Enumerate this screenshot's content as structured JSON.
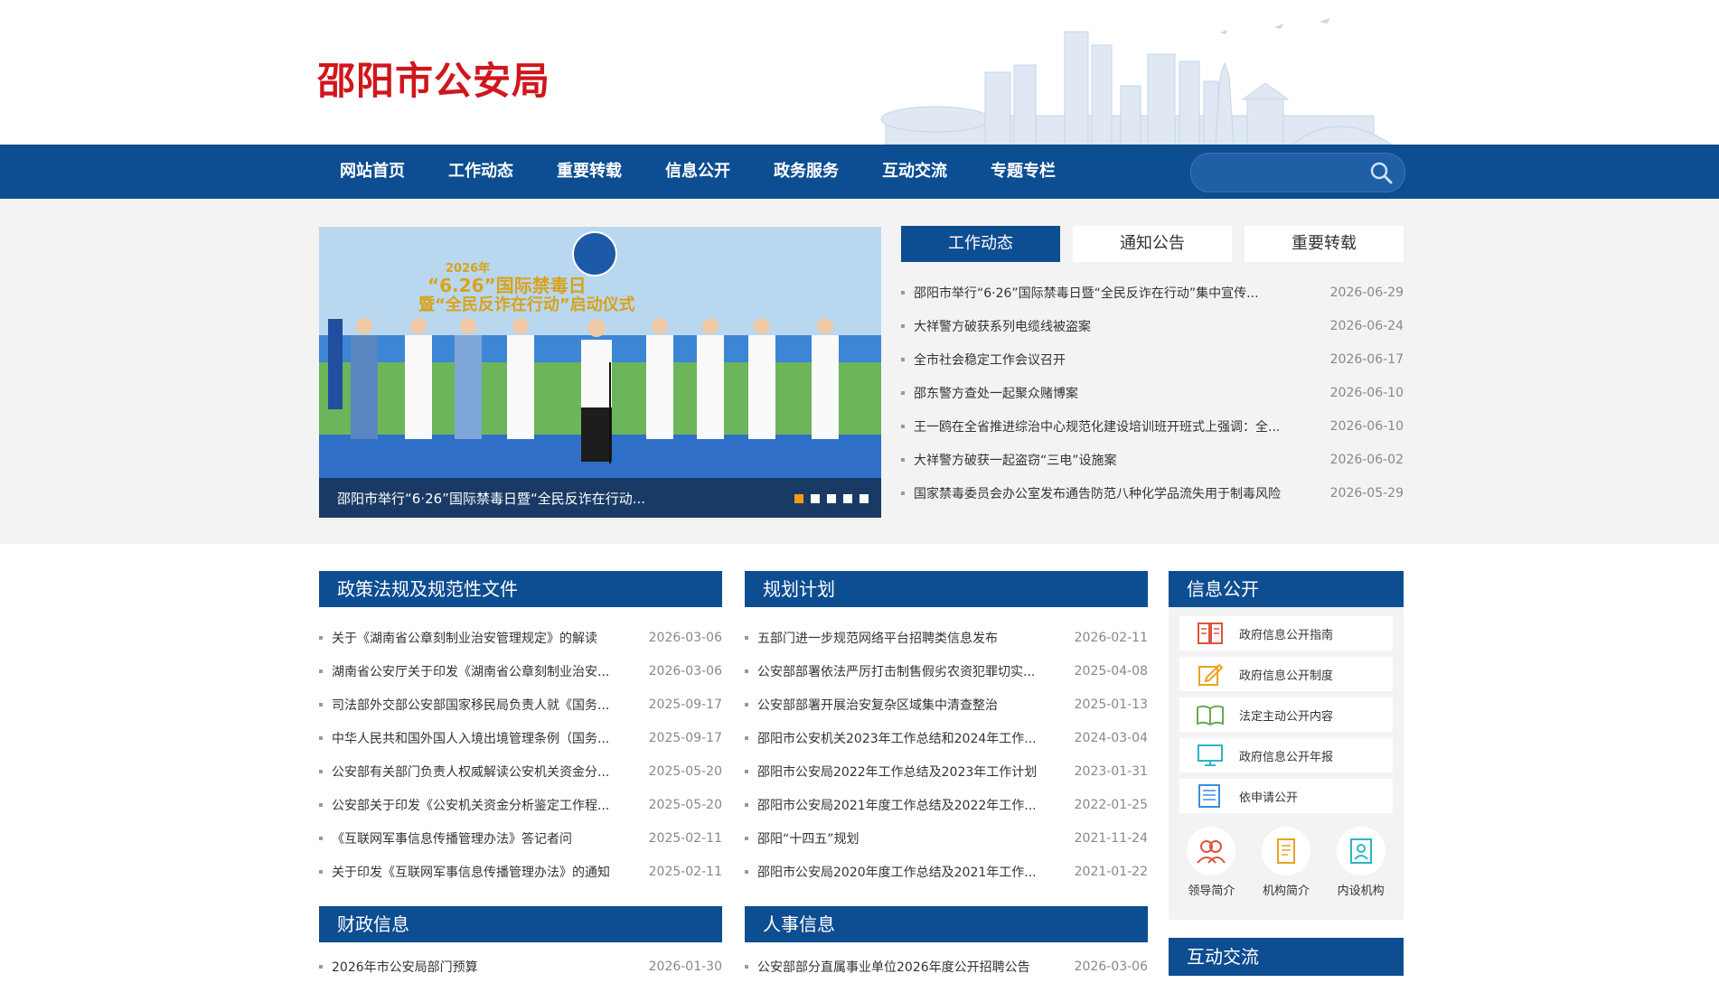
{
  "site": {
    "title": "邵阳市公安局"
  },
  "nav": {
    "items": [
      "网站首页",
      "工作动态",
      "重要转载",
      "信息公开",
      "政务服务",
      "互动交流",
      "专题专栏"
    ],
    "search_placeholder": ""
  },
  "slider": {
    "caption": "邵阳市举行“6·26”国际禁毒日暨“全民反诈在行动...",
    "banner_line1": "2026年",
    "banner_line2": "“6.26”国际禁毒日",
    "banner_line3": "暨“全民反诈在行动”启动仪式"
  },
  "tabs": [
    "工作动态",
    "通知公告",
    "重要转载"
  ],
  "top_news": [
    {
      "title": "邵阳市举行“6·26”国际禁毒日暨“全民反诈在行动”集中宣传...",
      "date": "2026-06-29"
    },
    {
      "title": "大祥警方破获系列电缆线被盗案",
      "date": "2026-06-24"
    },
    {
      "title": "全市社会稳定工作会议召开",
      "date": "2026-06-17"
    },
    {
      "title": "邵东警方查处一起聚众赌博案",
      "date": "2026-06-10"
    },
    {
      "title": "王一鸥在全省推进综治中心规范化建设培训班开班式上强调：全...",
      "date": "2026-06-10"
    },
    {
      "title": "大祥警方破获一起盗窃“三电”设施案",
      "date": "2026-06-02"
    },
    {
      "title": "国家禁毒委员会办公室发布通告防范八种化学品流失用于制毒风险",
      "date": "2026-05-29"
    }
  ],
  "policy": {
    "heading": "政策法规及规范性文件",
    "items": [
      {
        "title": "关于《湖南省公章刻制业治安管理规定》的解读",
        "date": "2026-03-06"
      },
      {
        "title": "湖南省公安厅关于印发《湖南省公章刻制业治安...",
        "date": "2026-03-06"
      },
      {
        "title": "司法部外交部公安部国家移民局负责人就《国务...",
        "date": "2025-09-17"
      },
      {
        "title": "中华人民共和国外国人入境出境管理条例（国务...",
        "date": "2025-09-17"
      },
      {
        "title": "公安部有关部门负责人权威解读公安机关资金分...",
        "date": "2025-05-20"
      },
      {
        "title": "公安部关于印发《公安机关资金分析鉴定工作程...",
        "date": "2025-05-20"
      },
      {
        "title": "《互联网军事信息传播管理办法》答记者问",
        "date": "2025-02-11"
      },
      {
        "title": "关于印发《互联网军事信息传播管理办法》的通知",
        "date": "2025-02-11"
      }
    ]
  },
  "planning": {
    "heading": "规划计划",
    "items": [
      {
        "title": "五部门进一步规范网络平台招聘类信息发布",
        "date": "2026-02-11"
      },
      {
        "title": "公安部部署依法严厉打击制售假劣农资犯罪切实...",
        "date": "2025-04-08"
      },
      {
        "title": "公安部部署开展治安复杂区域集中清查整治",
        "date": "2025-01-13"
      },
      {
        "title": "邵阳市公安机关2023年工作总结和2024年工作...",
        "date": "2024-03-04"
      },
      {
        "title": "邵阳市公安局2022年工作总结及2023年工作计划",
        "date": "2023-01-31"
      },
      {
        "title": "邵阳市公安局2021年度工作总结及2022年工作...",
        "date": "2022-01-25"
      },
      {
        "title": "邵阳“十四五”规划",
        "date": "2021-11-24"
      },
      {
        "title": "邵阳市公安局2020年度工作总结及2021年工作...",
        "date": "2021-01-22"
      }
    ]
  },
  "finance": {
    "heading": "财政信息",
    "items": [
      {
        "title": "2026年市公安局部门预算",
        "date": "2026-01-30"
      }
    ]
  },
  "personnel": {
    "heading": "人事信息",
    "items": [
      {
        "title": "公安部部分直属事业单位2026年度公开招聘公告",
        "date": "2026-03-06"
      }
    ]
  },
  "info_public": {
    "heading": "信息公开",
    "items": [
      {
        "label": "政府信息公开指南",
        "icon": "book-icon"
      },
      {
        "label": "政府信息公开制度",
        "icon": "edit-icon"
      },
      {
        "label": "法定主动公开内容",
        "icon": "open-book-icon"
      },
      {
        "label": "政府信息公开年报",
        "icon": "monitor-icon"
      },
      {
        "label": "依申请公开",
        "icon": "document-list-icon"
      }
    ],
    "circles": [
      {
        "label": "领导简介",
        "icon": "people-icon"
      },
      {
        "label": "机构简介",
        "icon": "note-icon"
      },
      {
        "label": "内设机构",
        "icon": "person-card-icon"
      }
    ]
  },
  "interact": {
    "heading": "互动交流"
  },
  "colors": {
    "primary": "#0d4d91",
    "title_red": "#d0161d",
    "active_dot": "#f39c12"
  }
}
